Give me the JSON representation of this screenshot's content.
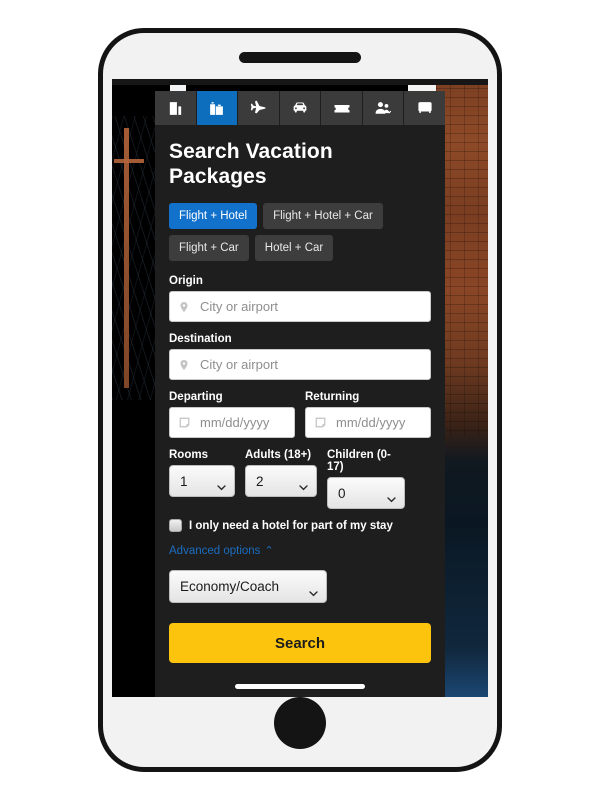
{
  "device": {
    "name": "smartphone-mockup",
    "speaker": "earpiece-speaker",
    "home_button": "home-button"
  },
  "product_nav": {
    "items": [
      {
        "icon": "hotel-building-icon",
        "label": "Hotels",
        "active": false
      },
      {
        "icon": "vacation-package-bag-icon",
        "label": "Vacation Packages",
        "active": true
      },
      {
        "icon": "airplane-icon",
        "label": "Flights",
        "active": false
      },
      {
        "icon": "car-icon",
        "label": "Cars",
        "active": false
      },
      {
        "icon": "ticket-icon",
        "label": "Things to Do",
        "active": false
      },
      {
        "icon": "people-group-icon",
        "label": "Groups",
        "active": false
      },
      {
        "icon": "bus-icon",
        "label": "Buses",
        "active": false
      }
    ],
    "active_color": "#0d6ebe",
    "bar_color": "#3b3b3b"
  },
  "form": {
    "title": "Search Vacation Packages",
    "package_tabs": [
      {
        "label": "Flight + Hotel",
        "active": true
      },
      {
        "label": "Flight + Hotel + Car",
        "active": false
      },
      {
        "label": "Flight + Car",
        "active": false
      },
      {
        "label": "Hotel + Car",
        "active": false
      }
    ],
    "origin": {
      "label": "Origin",
      "placeholder": "City or airport",
      "value": "",
      "icon": "map-pin-icon"
    },
    "destination": {
      "label": "Destination",
      "placeholder": "City or airport",
      "value": "",
      "icon": "map-pin-icon"
    },
    "departing": {
      "label": "Departing",
      "placeholder": "mm/dd/yyyy",
      "value": "",
      "icon": "calendar-icon"
    },
    "returning": {
      "label": "Returning",
      "placeholder": "mm/dd/yyyy",
      "value": "",
      "icon": "calendar-icon"
    },
    "rooms": {
      "label": "Rooms",
      "value": "1"
    },
    "adults": {
      "label": "Adults (18+)",
      "value": "2"
    },
    "children": {
      "label": "Children (0-17)",
      "value": "0"
    },
    "partial_stay": {
      "label": "I only need a hotel for part of my stay",
      "checked": false
    },
    "advanced_options": {
      "label": "Advanced options",
      "caret": "⌃",
      "expanded": true,
      "link_color": "#1b6ec2"
    },
    "cabin_class": {
      "value": "Economy/Coach"
    },
    "search_button": {
      "label": "Search",
      "color": "#fcc40c"
    }
  },
  "theme": {
    "panel_background": "#1e1e1e",
    "accent_blue": "#1272cb",
    "button_yellow": "#fcc40c"
  }
}
